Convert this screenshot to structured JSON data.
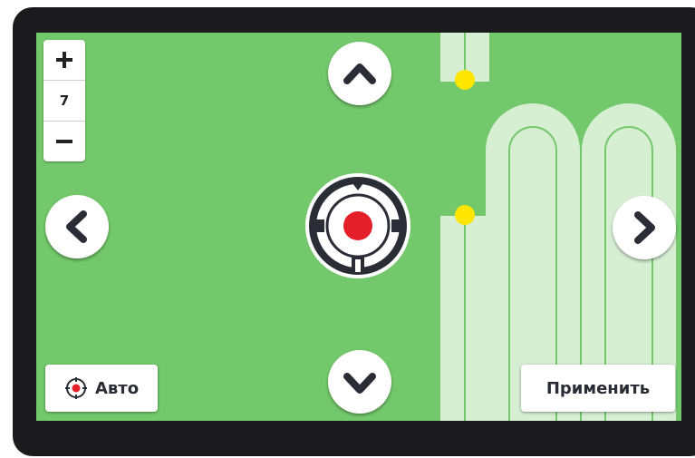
{
  "zoom": {
    "value": "7",
    "plus_icon": "plus-icon",
    "minus_icon": "minus-icon"
  },
  "nav": {
    "up_icon": "chevron-up-icon",
    "down_icon": "chevron-down-icon",
    "left_icon": "chevron-left-icon",
    "right_icon": "chevron-right-icon"
  },
  "auto_button": {
    "label": "Авто",
    "icon": "target-icon"
  },
  "apply_button": {
    "label": "Применить"
  },
  "colors": {
    "field": "#72c86a",
    "track": "#d6efd3",
    "marker": "#ffe600",
    "crosshair_center": "#e41f2a",
    "dark": "#2b2d36",
    "bezel": "#1b1b1d"
  }
}
